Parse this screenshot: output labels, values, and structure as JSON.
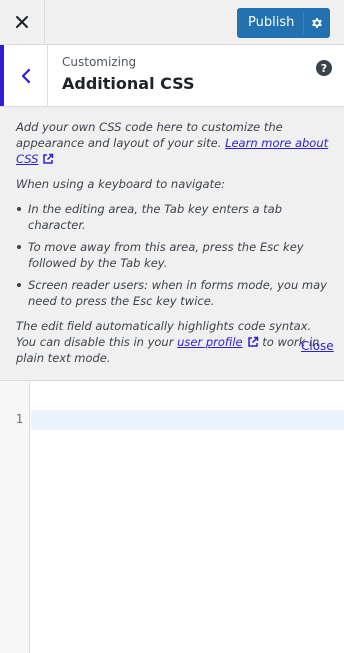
{
  "topbar": {
    "close_icon": "close-icon",
    "publish_label": "Publish",
    "settings_icon": "gear-icon"
  },
  "header": {
    "back_icon": "chevron-left-icon",
    "breadcrumb": "Customizing",
    "title": "Additional CSS",
    "help_label": "?"
  },
  "description": {
    "intro": "Add your own CSS code here to customize the appearance and layout of your site.",
    "learn_more_link": "Learn more about CSS",
    "keyboard_heading": "When using a keyboard to navigate:",
    "bullets": [
      "In the editing area, the Tab key enters a tab character.",
      "To move away from this area, press the Esc key followed by the Tab key.",
      "Screen reader users: when in forms mode, you may need to press the Esc key twice."
    ],
    "syntax_note_before": "The edit field automatically highlights code syntax. You can disable this in your",
    "user_profile_link": "user profile",
    "syntax_note_after": "to work in plain text mode.",
    "close_link": "Close"
  },
  "editor": {
    "line_numbers": [
      "1"
    ],
    "content": ""
  },
  "colors": {
    "accent": "#2271b1",
    "link": "#2c1fd6",
    "active_line": "#eaf2fd"
  }
}
